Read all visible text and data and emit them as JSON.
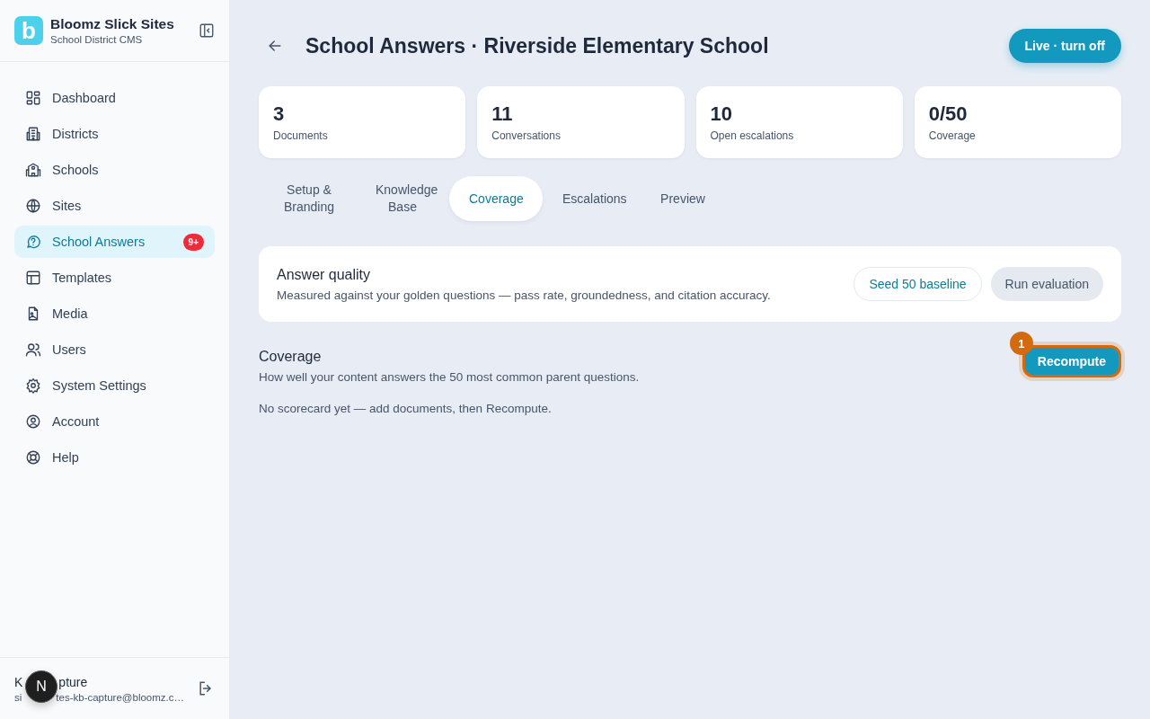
{
  "brand": {
    "logo": "b",
    "name": "Bloomz Slick Sites",
    "subtitle": "School District CMS"
  },
  "nav": [
    {
      "label": "Dashboard",
      "selected": false
    },
    {
      "label": "Districts",
      "selected": false
    },
    {
      "label": "Schools",
      "selected": false
    },
    {
      "label": "Sites",
      "selected": false
    },
    {
      "label": "School Answers",
      "selected": true,
      "badge": "9+"
    },
    {
      "label": "Templates",
      "selected": false
    },
    {
      "label": "Media",
      "selected": false
    },
    {
      "label": "Users",
      "selected": false
    },
    {
      "label": "System Settings",
      "selected": false
    },
    {
      "label": "Account",
      "selected": false
    },
    {
      "label": "Help",
      "selected": false
    }
  ],
  "user": {
    "name_parts": [
      "K",
      "pture"
    ],
    "email_parts": [
      "si",
      "tes-kb-capture@bloomz.c…"
    ],
    "overlay_badge": "N"
  },
  "page": {
    "title": "School Answers · Riverside Elementary School",
    "live_button": "Live · turn off"
  },
  "stats": [
    {
      "value": "3",
      "label": "Documents"
    },
    {
      "value": "11",
      "label": "Conversations"
    },
    {
      "value": "10",
      "label": "Open escalations"
    },
    {
      "value": "0/50",
      "label": "Coverage"
    }
  ],
  "tabs": [
    {
      "label": "Setup & Branding",
      "selected": false
    },
    {
      "label": "Knowledge Base",
      "selected": false
    },
    {
      "label": "Coverage",
      "selected": true
    },
    {
      "label": "Escalations",
      "selected": false
    },
    {
      "label": "Preview",
      "selected": false
    }
  ],
  "quality": {
    "title": "Answer quality",
    "description": "Measured against your golden questions — pass rate, groundedness, and citation accuracy.",
    "buttons": [
      {
        "label": "Seed 50 baseline",
        "kind": "outline"
      },
      {
        "label": "Run evaluation",
        "kind": "muted"
      }
    ]
  },
  "coverage": {
    "title": "Coverage",
    "description": "How well your content answers the 50 most common parent questions.",
    "button": "Recompute",
    "annotation": "1",
    "empty": "No scorecard yet — add documents, then Recompute."
  }
}
